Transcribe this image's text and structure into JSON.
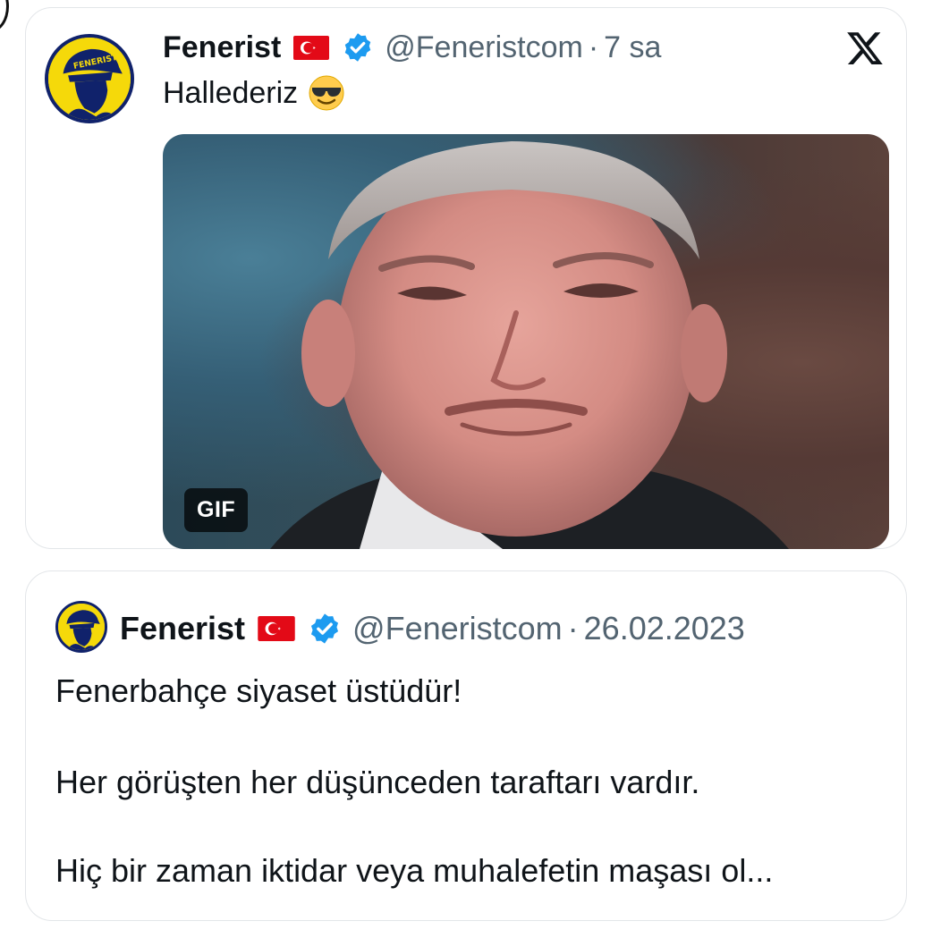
{
  "main_tweet": {
    "display_name": "Fenerist",
    "handle": "@Feneristcom",
    "separator": "·",
    "time": "7 sa",
    "text": "Hallederiz",
    "emoji": "smiling-face-with-sunglasses",
    "media": {
      "badge": "GIF"
    },
    "platform_icon": "x-logo-icon",
    "avatar_text": "FENERIST"
  },
  "quoted_tweet": {
    "display_name": "Fenerist",
    "handle": "@Feneristcom",
    "separator": "·",
    "date": "26.02.2023",
    "lines": [
      "Fenerbahçe siyaset üstüdür!",
      "Her görüşten her düşünceden taraftarı vardır.",
      "Hiç bir zaman iktidar veya muhalefetin maşası ol..."
    ]
  },
  "colors": {
    "verified_blue": "#1d9bf0",
    "flag_red": "#e30a17",
    "secondary_text": "#536471",
    "avatar_yellow": "#f5d90a",
    "avatar_navy": "#10226b"
  }
}
